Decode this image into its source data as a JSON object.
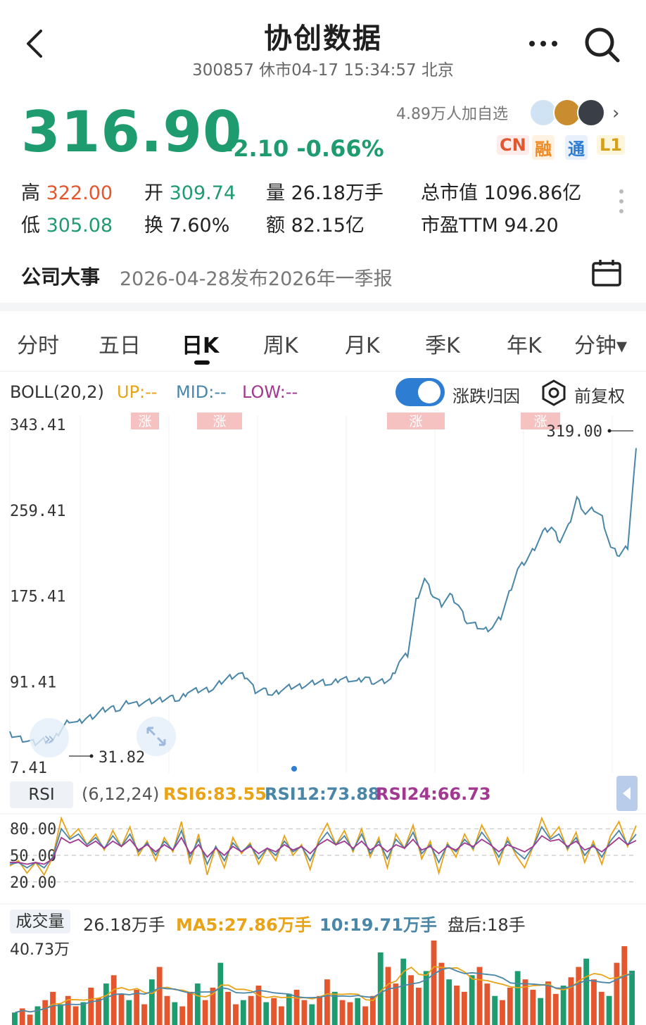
{
  "header": {
    "title": "协创数据",
    "subtitle": "300857 休市04-17 15:34:57 北京"
  },
  "quote": {
    "price": "316.90",
    "change": "-2.10 -0.66%",
    "followers": "4.89万人加自选",
    "tags": [
      "CN",
      "融",
      "通",
      "L1"
    ],
    "stats": [
      {
        "label": "高",
        "value": "322.00"
      },
      {
        "label": "开",
        "value": "309.74"
      },
      {
        "label": "量",
        "value": "26.18万手"
      },
      {
        "label": "总市值",
        "value": "1096.86亿"
      },
      {
        "label": "低",
        "value": "305.08"
      },
      {
        "label": "换",
        "value": "7.60%"
      },
      {
        "label": "额",
        "value": "82.15亿"
      },
      {
        "label": "市盈TTM",
        "value": "94.20"
      }
    ]
  },
  "event": {
    "label": "公司大事",
    "text": "2026-04-28发布2026年一季报"
  },
  "tabs": [
    "分时",
    "五日",
    "日K",
    "周K",
    "月K",
    "季K",
    "年K",
    "分钟▾"
  ],
  "active_tab": "日K",
  "boll": {
    "name": "BOLL(20,2)",
    "up": "UP:--",
    "mid": "MID:--",
    "low": "LOW:--",
    "toggle_label": "涨跌归因",
    "adjust_label": "前复权"
  },
  "price_axis": [
    "343.41",
    "259.41",
    "175.41",
    "91.41",
    "7.41"
  ],
  "markers": {
    "rise_label": "涨",
    "high": "319.00",
    "low": "31.82"
  },
  "rsi": {
    "button": "RSI",
    "params": "(6,12,24)",
    "rsi6": "RSI6:83.55",
    "rsi12": "RSI12:73.88",
    "rsi24": "RSI24:66.73",
    "axis": [
      "80.00",
      "50.00",
      "20.00"
    ]
  },
  "volume": {
    "button": "成交量",
    "value": "26.18万手",
    "ma5": "MA5:27.86万手",
    "ma10": "10:19.71万手",
    "after_hours": "盘后:18手",
    "axis_top": "40.73万"
  },
  "colors": {
    "down_green": "#1f9c6f",
    "up_red": "#e4572e",
    "accent_blue": "#2d7dd2",
    "price_line": "#4a86a8",
    "rsi6": "#e8a317",
    "rsi12": "#4a86a8",
    "rsi24": "#a2388f"
  },
  "chart_data": [
    {
      "type": "line",
      "title": "",
      "series": [
        {
          "name": "",
          "values": [
            38,
            36,
            34,
            33,
            33,
            31.82,
            45,
            52,
            50,
            56,
            60,
            62,
            66,
            65,
            70,
            69,
            72,
            74,
            73,
            76,
            74,
            80,
            82,
            84,
            86,
            90,
            96,
            100,
            94,
            82,
            84,
            80,
            82,
            86,
            88,
            86,
            90,
            92,
            90,
            93,
            94,
            92,
            94,
            90,
            92,
            95,
            110,
            118,
            172,
            190,
            175,
            168,
            178,
            165,
            150,
            148,
            140,
            144,
            155,
            180,
            200,
            210,
            224,
            236,
            242,
            230,
            245,
            270,
            256,
            262,
            250,
            222,
            216,
            226,
            319
          ]
        }
      ],
      "ylim": [
        7.41,
        343.41
      ],
      "yticks": [
        343.41,
        259.41,
        175.41,
        91.41,
        7.41
      ],
      "grid": true
    },
    {
      "type": "line",
      "series": [
        {
          "name": "RSI6",
          "values": [
            38,
            44,
            30,
            42,
            28,
            48,
            92,
            70,
            80,
            62,
            74,
            56,
            78,
            60,
            82,
            50,
            66,
            44,
            70,
            54,
            88,
            40,
            74,
            28,
            60,
            36,
            70,
            52,
            64,
            40,
            58,
            44,
            72,
            50,
            62,
            34,
            68,
            86,
            62,
            78,
            54,
            80,
            48,
            70,
            36,
            74,
            58,
            84,
            46,
            66,
            30,
            64,
            48,
            74,
            56,
            84,
            66,
            40,
            70,
            50,
            36,
            60,
            92,
            70,
            82,
            56,
            76,
            42,
            66,
            40,
            72,
            88,
            60,
            83.55
          ]
        },
        {
          "name": "RSI12",
          "values": [
            40,
            42,
            36,
            42,
            36,
            48,
            80,
            68,
            74,
            62,
            70,
            58,
            72,
            60,
            74,
            54,
            64,
            50,
            66,
            56,
            78,
            48,
            68,
            40,
            60,
            44,
            64,
            54,
            62,
            46,
            58,
            50,
            66,
            54,
            60,
            44,
            64,
            76,
            62,
            72,
            56,
            74,
            52,
            66,
            46,
            68,
            58,
            76,
            52,
            62,
            42,
            62,
            54,
            68,
            58,
            76,
            64,
            48,
            66,
            54,
            46,
            60,
            82,
            68,
            74,
            58,
            70,
            50,
            62,
            48,
            66,
            78,
            62,
            73.88
          ]
        },
        {
          "name": "RSI24",
          "values": [
            42,
            42,
            40,
            42,
            40,
            46,
            70,
            64,
            68,
            60,
            66,
            58,
            66,
            60,
            68,
            56,
            62,
            54,
            62,
            56,
            70,
            52,
            62,
            48,
            58,
            50,
            60,
            54,
            60,
            52,
            58,
            54,
            62,
            56,
            60,
            52,
            62,
            68,
            62,
            66,
            58,
            66,
            56,
            62,
            54,
            62,
            58,
            68,
            56,
            60,
            52,
            60,
            56,
            64,
            60,
            68,
            62,
            54,
            62,
            58,
            54,
            60,
            72,
            66,
            68,
            60,
            66,
            56,
            60,
            54,
            62,
            70,
            62,
            66.73
          ]
        }
      ],
      "ylim": [
        0,
        100
      ],
      "yticks": [
        80,
        50,
        20
      ]
    },
    {
      "type": "bar",
      "title": "成交量",
      "values": [
        6,
        8,
        5,
        9,
        12,
        16,
        10,
        14,
        9,
        11,
        18,
        13,
        20,
        24,
        15,
        12,
        17,
        10,
        22,
        28,
        14,
        11,
        9,
        16,
        20,
        12,
        18,
        30,
        16,
        10,
        12,
        14,
        19,
        11,
        13,
        9,
        15,
        17,
        12,
        10,
        14,
        22,
        16,
        12,
        11,
        13,
        9,
        14,
        35,
        28,
        20,
        32,
        24,
        18,
        26,
        40.73,
        30,
        22,
        19,
        16,
        24,
        28,
        20,
        14,
        12,
        18,
        26,
        22,
        17,
        13,
        21,
        15,
        19,
        23,
        28,
        32,
        22,
        16,
        14,
        30,
        38,
        26.18
      ],
      "ylim": [
        0,
        40.73
      ],
      "unit": "万手"
    }
  ]
}
